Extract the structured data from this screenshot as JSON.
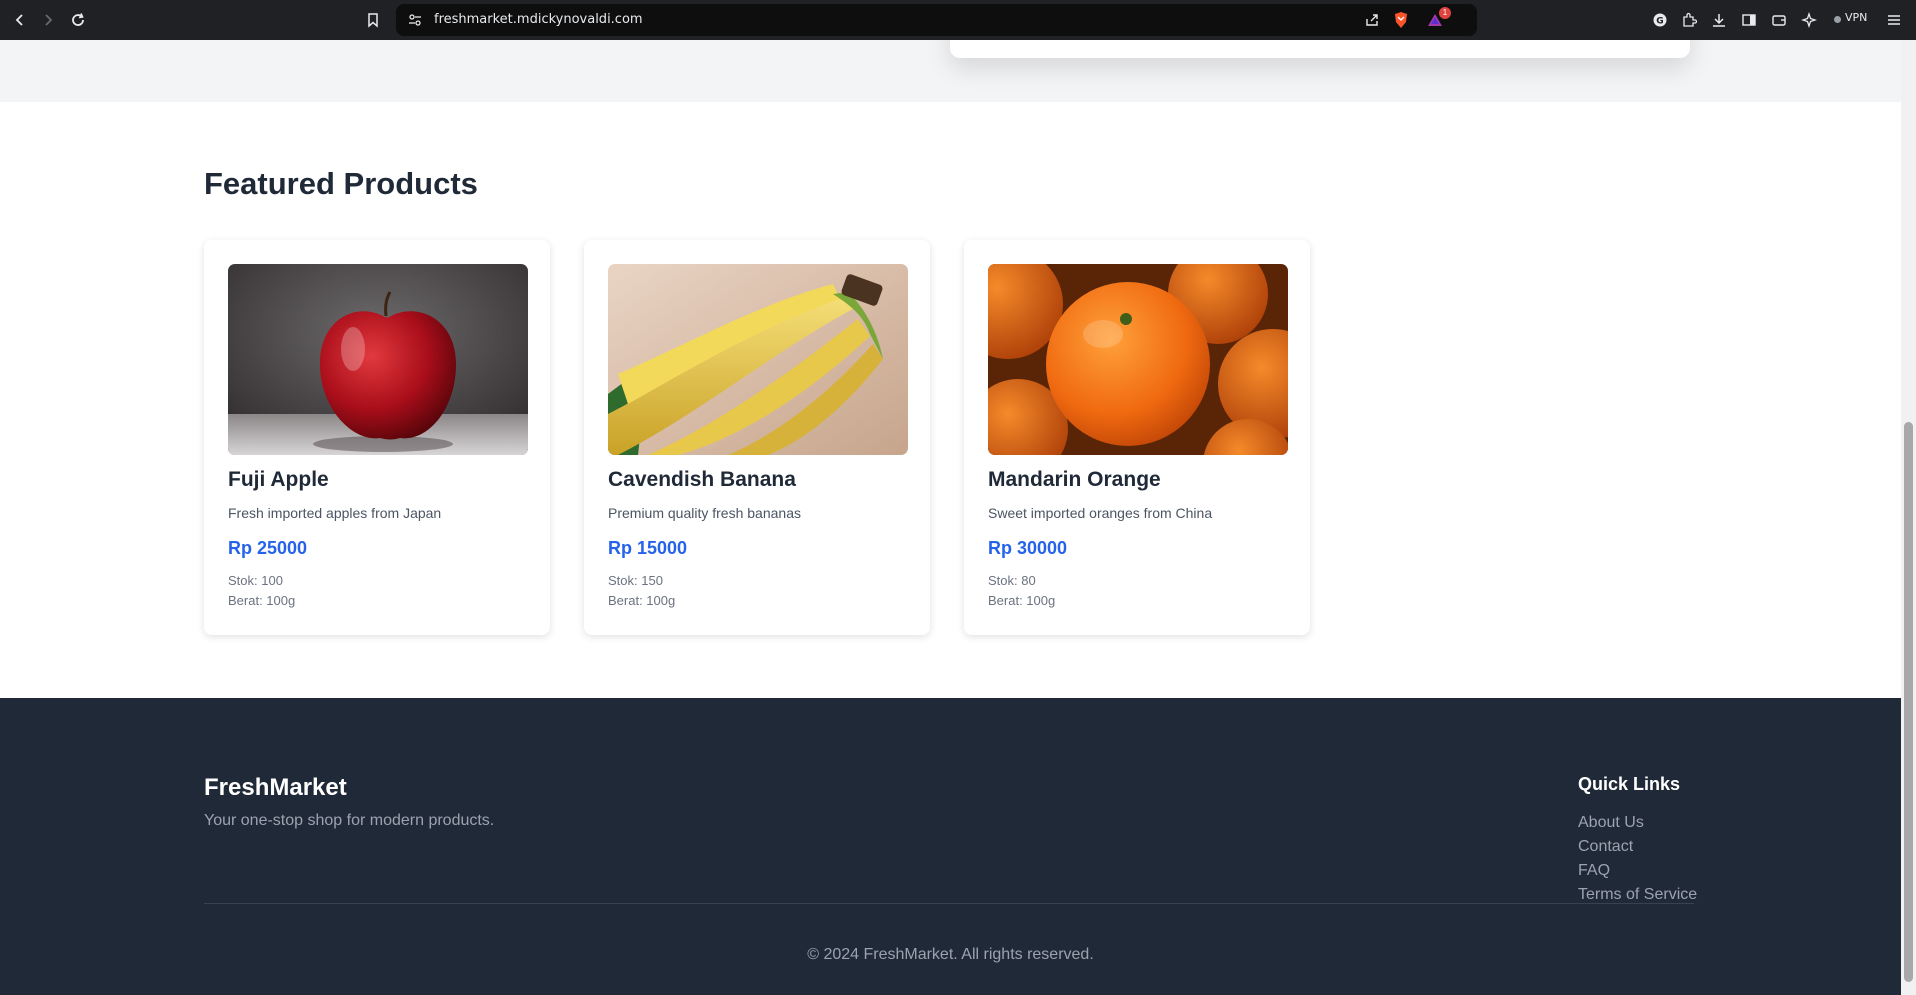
{
  "browser": {
    "url": "freshmarket.mdickynovaldi.com",
    "vpn_label": "VPN",
    "alert_count": "1"
  },
  "section": {
    "title": "Featured Products"
  },
  "products": [
    {
      "name": "Fuji Apple",
      "description": "Fresh imported apples from Japan",
      "price": "Rp 25000",
      "stock": "Stok: 100",
      "weight": "Berat: 100g"
    },
    {
      "name": "Cavendish Banana",
      "description": "Premium quality fresh bananas",
      "price": "Rp 15000",
      "stock": "Stok: 150",
      "weight": "Berat: 100g"
    },
    {
      "name": "Mandarin Orange",
      "description": "Sweet imported oranges from China",
      "price": "Rp 30000",
      "stock": "Stok: 80",
      "weight": "Berat: 100g"
    }
  ],
  "footer": {
    "brand": "FreshMarket",
    "tagline": "Your one-stop shop for modern products.",
    "quick_links_title": "Quick Links",
    "quick_links": [
      "About Us",
      "Contact",
      "FAQ",
      "Terms of Service"
    ],
    "copyright": "© 2024 FreshMarket. All rights reserved."
  },
  "colors": {
    "accent": "#2563eb",
    "footer_bg": "#1f2937",
    "heading": "#1f2937"
  }
}
